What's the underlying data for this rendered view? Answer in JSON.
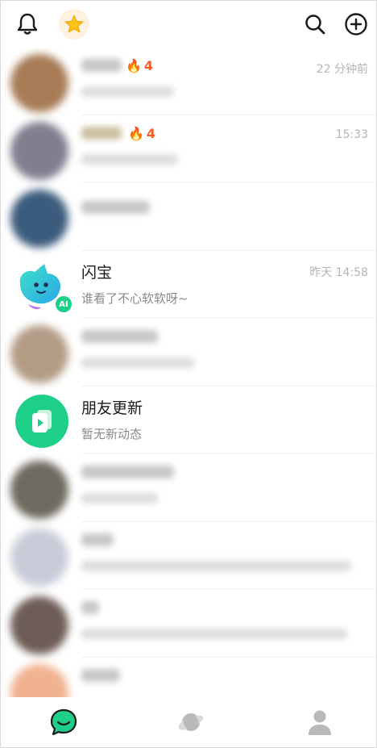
{
  "topbar": {
    "icons": [
      "bell-icon",
      "star-icon",
      "search-icon",
      "add-circle-icon"
    ]
  },
  "chats": [
    {
      "streak": "4",
      "time": "22 分钟前",
      "avatar_color": "#a77b55"
    },
    {
      "streak": "4",
      "time": "15:33",
      "avatar_color": "#7f7f8e"
    },
    {
      "streak": "",
      "time": "",
      "avatar_color": "#3b5c7c"
    },
    {
      "name": "闪宝",
      "message": "谁看了不心软软呀~",
      "time": "昨天 14:58",
      "badge": "AI"
    },
    {
      "streak": "",
      "time": "",
      "avatar_color": "#b39c86"
    },
    {
      "name": "朋友更新",
      "message": "暂无新动态"
    },
    {
      "streak": "",
      "time": "",
      "avatar_color": "#6f6a60"
    },
    {
      "streak": "",
      "time": "",
      "avatar_color": "#c9ccd8"
    },
    {
      "streak": "",
      "time": "",
      "avatar_color": "#6e5d56"
    },
    {
      "streak": "",
      "time": "",
      "avatar_color": "#f1b28f"
    }
  ],
  "tabs": [
    "chat-tab",
    "discover-tab",
    "profile-tab"
  ],
  "colors": {
    "accent": "#1ecf8a",
    "streak": "#ff5a1f"
  }
}
